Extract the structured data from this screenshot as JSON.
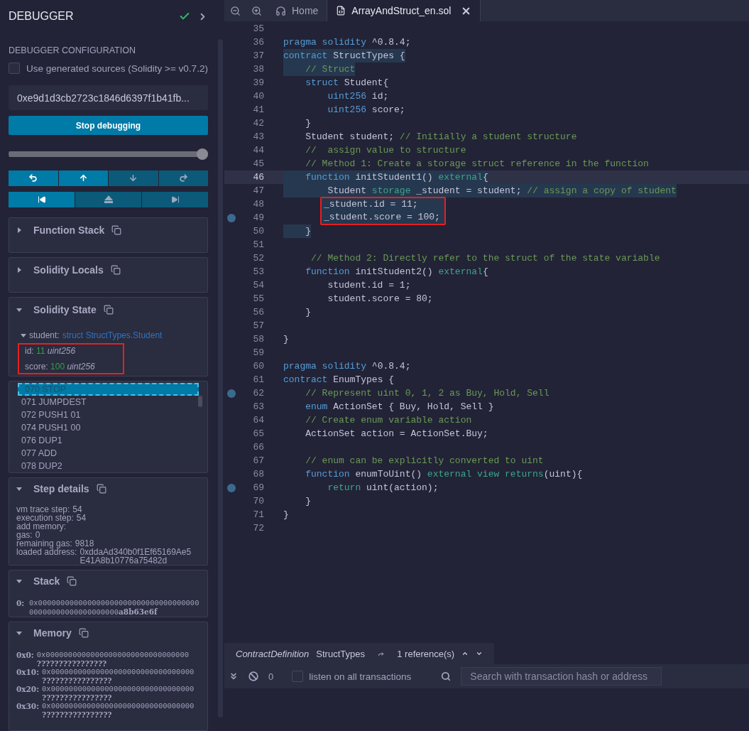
{
  "sidebar": {
    "title": "DEBUGGER",
    "status_ok": true,
    "config_heading": "DEBUGGER CONFIGURATION",
    "generated_sources": {
      "label": "Use generated sources (Solidity >= v0.7.2)",
      "checked": false
    },
    "tx_hash": {
      "value": "0xe9d1d3cb2723c1846d6397f1b41fb..."
    },
    "stop_button": "Stop debugging",
    "slider": {
      "level": 1
    },
    "step_row_1": [
      {
        "enabled": true
      },
      {
        "enabled": true
      },
      {
        "enabled": false
      },
      {
        "enabled": false
      }
    ],
    "step_row_2": [
      {
        "enabled": true
      },
      {
        "enabled": false
      },
      {
        "enabled": false
      }
    ],
    "panels": [
      {
        "kind": "plain",
        "title": "Function Stack",
        "expanded": false
      },
      {
        "kind": "plain",
        "title": "Solidity Locals",
        "expanded": false
      },
      {
        "kind": "state",
        "title": "Solidity State",
        "expanded": true,
        "root": {
          "name": "student:",
          "type": "struct StructTypes.Student",
          "expanded": true
        },
        "fields": [
          {
            "name": "id:",
            "value": "11",
            "type": "uint256",
            "boxed": true
          },
          {
            "name": "score:",
            "value": "100",
            "type": "uint256",
            "boxed": true
          }
        ]
      },
      {
        "kind": "opcodes",
        "items": [
          {
            "text": "070 STOP",
            "selected": true
          },
          {
            "text": "071 JUMPDEST",
            "selected": false
          },
          {
            "text": "072 PUSH1 01",
            "selected": false
          },
          {
            "text": "074 PUSH1 00",
            "selected": false
          },
          {
            "text": "076 DUP1",
            "selected": false
          },
          {
            "text": "077 ADD",
            "selected": false
          },
          {
            "text": "078 DUP2",
            "selected": false
          }
        ]
      },
      {
        "kind": "details",
        "title": "Step details",
        "expanded": true,
        "rows": [
          {
            "label": "vm trace step:",
            "value": "54"
          },
          {
            "label": "execution step:",
            "value": "54"
          },
          {
            "label": "add memory:"
          },
          {
            "label": "gas:",
            "value": "0"
          },
          {
            "label": "remaining gas:",
            "value": "9818"
          },
          {
            "label": "loaded address:",
            "value": "0xddaAd340b0f1Ef65169Ae5E41A8b10776a75482d"
          }
        ]
      },
      {
        "kind": "stack",
        "title": "Stack",
        "expanded": true,
        "entries": [
          {
            "index": "0:",
            "value": "0x00000000000000000000000000000000000000000000000000000000",
            "tail": "a8b63e6f"
          }
        ]
      },
      {
        "kind": "memory",
        "title": "Memory",
        "expanded": true,
        "entries": [
          {
            "address": "0x0:",
            "hex": "0x00000000000000000000000000000000",
            "ascii": "????????????????"
          },
          {
            "address": "0x10:",
            "hex": "0x00000000000000000000000000000000",
            "ascii": "????????????????"
          },
          {
            "address": "0x20:",
            "hex": "0x00000000000000000000000000000000",
            "ascii": "????????????????"
          },
          {
            "address": "0x30:",
            "hex": "0x00000000000000000000000000000000",
            "ascii": "????????????????"
          }
        ]
      }
    ]
  },
  "editor": {
    "tabs": [
      {
        "label": "Home",
        "selected": false,
        "closable": false
      },
      {
        "label": "ArrayAndStruct_en.sol",
        "selected": true,
        "closable": true
      }
    ],
    "lines": [
      {
        "number": "35"
      },
      {
        "number": "36",
        "tokens": [
          {
            "kind": "kw",
            "text": "pragma solidity"
          },
          {
            "kind": "plain",
            "text": " ^0.8.4;"
          }
        ]
      },
      {
        "number": "37",
        "highlighted": true,
        "tokens": [
          {
            "kind": "kw",
            "text": "contract"
          },
          {
            "kind": "plain",
            "text": " StructTypes {"
          }
        ]
      },
      {
        "number": "38",
        "highlighted": true,
        "tokens": [
          {
            "kind": "comment",
            "text": "    // Struct"
          }
        ]
      },
      {
        "number": "39",
        "tokens": [
          {
            "kind": "kw",
            "text": "    struct"
          },
          {
            "kind": "plain",
            "text": " Student{"
          }
        ]
      },
      {
        "number": "40",
        "tokens": [
          {
            "kind": "kw",
            "text": "        uint256"
          },
          {
            "kind": "plain",
            "text": " id;"
          }
        ]
      },
      {
        "number": "41",
        "tokens": [
          {
            "kind": "kw",
            "text": "        uint256"
          },
          {
            "kind": "plain",
            "text": " score;"
          }
        ]
      },
      {
        "number": "42",
        "tokens": [
          {
            "kind": "plain",
            "text": "    }"
          }
        ]
      },
      {
        "number": "43",
        "tokens": [
          {
            "kind": "plain",
            "text": "    Student student; "
          },
          {
            "kind": "comment",
            "text": "// Initially a student structure"
          }
        ]
      },
      {
        "number": "44",
        "tokens": [
          {
            "kind": "comment",
            "text": "    //  assign value to structure"
          }
        ]
      },
      {
        "number": "45",
        "tokens": [
          {
            "kind": "comment",
            "text": "    // Method 1: Create a storage struct reference in the function"
          }
        ]
      },
      {
        "number": "46",
        "current": true,
        "highlighted": true,
        "tokens": [
          {
            "kind": "kw",
            "text": "    function"
          },
          {
            "kind": "plain",
            "text": " initStudent1() "
          },
          {
            "kind": "mod",
            "text": "external"
          },
          {
            "kind": "plain",
            "text": "{"
          }
        ]
      },
      {
        "number": "47",
        "highlighted": true,
        "tokens": [
          {
            "kind": "plain",
            "text": "        Student "
          },
          {
            "kind": "mod",
            "text": "storage"
          },
          {
            "kind": "plain",
            "text": " _student = student; "
          },
          {
            "kind": "comment",
            "text": "// assign a copy of student"
          }
        ]
      },
      {
        "number": "48",
        "highlighted": true,
        "boxed": true,
        "tokens": [
          {
            "kind": "plain",
            "text": "        _student.id = 11;"
          }
        ]
      },
      {
        "number": "49",
        "highlighted": true,
        "boxed": true,
        "breakpoint": true,
        "tokens": [
          {
            "kind": "plain",
            "text": "        _student.score = 100;"
          }
        ]
      },
      {
        "number": "50",
        "highlighted": true,
        "tokens": [
          {
            "kind": "plain",
            "text": "    }"
          }
        ]
      },
      {
        "number": "51"
      },
      {
        "number": "52",
        "tokens": [
          {
            "kind": "comment",
            "text": "     // Method 2: Directly refer to the struct of the state variable"
          }
        ]
      },
      {
        "number": "53",
        "tokens": [
          {
            "kind": "kw",
            "text": "    function"
          },
          {
            "kind": "plain",
            "text": " initStudent2() "
          },
          {
            "kind": "mod",
            "text": "external"
          },
          {
            "kind": "plain",
            "text": "{"
          }
        ]
      },
      {
        "number": "54",
        "tokens": [
          {
            "kind": "plain",
            "text": "        student.id = 1;"
          }
        ]
      },
      {
        "number": "55",
        "tokens": [
          {
            "kind": "plain",
            "text": "        student.score = 80;"
          }
        ]
      },
      {
        "number": "56",
        "tokens": [
          {
            "kind": "plain",
            "text": "    }"
          }
        ]
      },
      {
        "number": "57"
      },
      {
        "number": "58",
        "tokens": [
          {
            "kind": "plain",
            "text": "}"
          }
        ]
      },
      {
        "number": "59"
      },
      {
        "number": "60",
        "tokens": [
          {
            "kind": "kw",
            "text": "pragma solidity"
          },
          {
            "kind": "plain",
            "text": " ^0.8.4;"
          }
        ]
      },
      {
        "number": "61",
        "tokens": [
          {
            "kind": "kw",
            "text": "contract"
          },
          {
            "kind": "plain",
            "text": " EnumTypes {"
          }
        ]
      },
      {
        "number": "62",
        "breakpoint": true,
        "tokens": [
          {
            "kind": "comment",
            "text": "    // Represent uint 0, 1, 2 as Buy, Hold, Sell"
          }
        ]
      },
      {
        "number": "63",
        "tokens": [
          {
            "kind": "kw",
            "text": "    enum"
          },
          {
            "kind": "plain",
            "text": " ActionSet { Buy, Hold, Sell }"
          }
        ]
      },
      {
        "number": "64",
        "tokens": [
          {
            "kind": "comment",
            "text": "    // Create enum variable action"
          }
        ]
      },
      {
        "number": "65",
        "tokens": [
          {
            "kind": "plain",
            "text": "    ActionSet action = ActionSet.Buy;"
          }
        ]
      },
      {
        "number": "66"
      },
      {
        "number": "67",
        "tokens": [
          {
            "kind": "comment",
            "text": "    // enum can be explicitly converted to uint"
          }
        ]
      },
      {
        "number": "68",
        "tokens": [
          {
            "kind": "kw",
            "text": "    function"
          },
          {
            "kind": "plain",
            "text": " enumToUint() "
          },
          {
            "kind": "mod",
            "text": "external view returns"
          },
          {
            "kind": "plain",
            "text": "(uint){"
          }
        ]
      },
      {
        "number": "69",
        "breakpoint": true,
        "tokens": [
          {
            "kind": "mod",
            "text": "        return"
          },
          {
            "kind": "plain",
            "text": " uint(action);"
          }
        ]
      },
      {
        "number": "70",
        "tokens": [
          {
            "kind": "plain",
            "text": "    }"
          }
        ]
      },
      {
        "number": "71",
        "tokens": [
          {
            "kind": "plain",
            "text": "}"
          }
        ]
      },
      {
        "number": "72"
      }
    ]
  },
  "reference_bar": {
    "kind_label": "ContractDefinition",
    "name": "StructTypes",
    "count": "1 reference(s)"
  },
  "terminal_bar": {
    "count": "0",
    "listen": {
      "label": "listen on all transactions",
      "checked": false
    },
    "search": {
      "placeholder": "Search with transaction hash or address"
    }
  }
}
